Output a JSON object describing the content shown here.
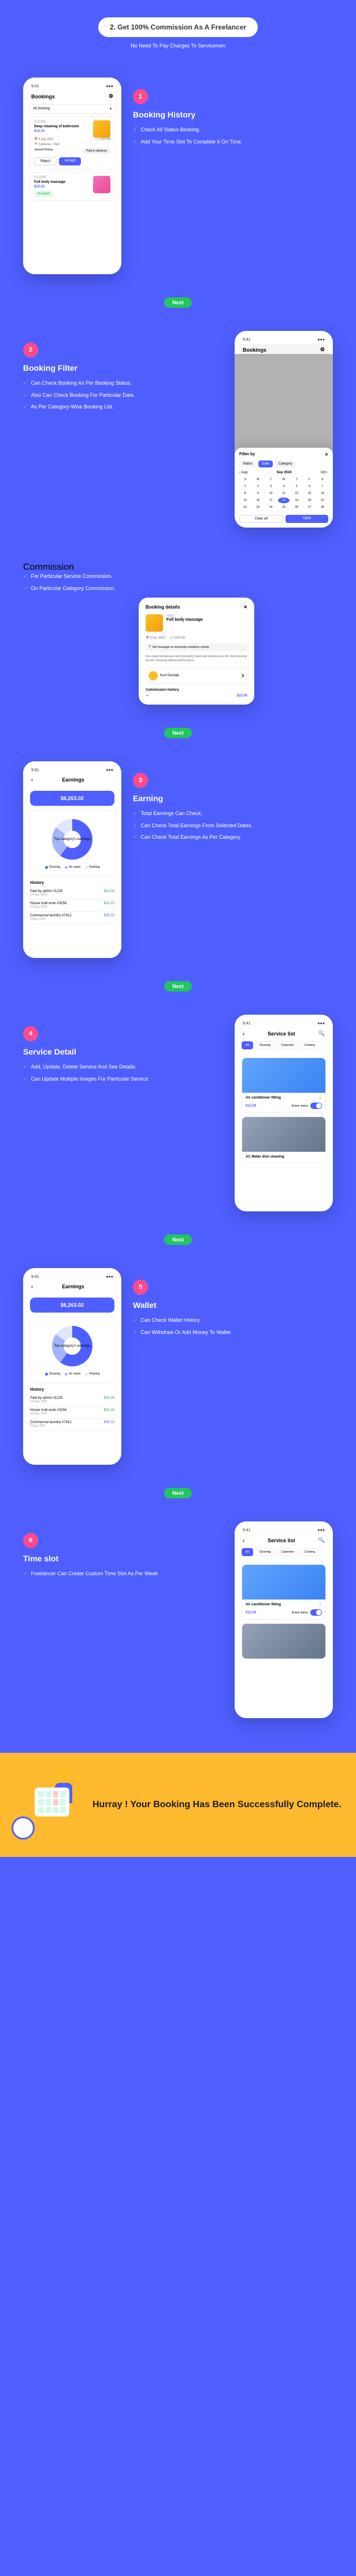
{
  "header": {
    "title": "2. Get 100% Commission As A Freelancer",
    "subtitle": "No Need To Pay Charges To Servicemen"
  },
  "next_label": "Next",
  "sections": {
    "s1": {
      "num": "1",
      "title": "Booking History",
      "items": [
        "Check All Status Booking.",
        "Add Your Time Slot To Complete It On Time."
      ],
      "phone": {
        "title": "Bookings",
        "filter_all": "All booking",
        "card1": {
          "id": "#15263",
          "name": "Deep cleaning of bathroom",
          "price": "$12.15",
          "date": "6 Sep 2023",
          "time": "6:00 PM",
          "location": "California - USA",
          "customer": "Javeed Khong",
          "payment": "Paid in advance",
          "btn_reject": "Reject",
          "btn_accept": "Accept"
        },
        "card2": {
          "id": "#12368",
          "name": "Full body massage",
          "price": "$15.23",
          "status": "Accepted"
        }
      }
    },
    "s2": {
      "num": "2",
      "title": "Booking Filter",
      "items": [
        "Can Check Booking As Per Booking Status.",
        "Also Can Check Booking For Particular Date.",
        "As Per Category-Wise Booking List."
      ],
      "phone": {
        "title": "Bookings",
        "filter_title": "Filter by",
        "tabs": [
          "Status",
          "Date",
          "Category"
        ],
        "month": "Sep 2024",
        "prev_month": "Aug",
        "next_month": "Oct",
        "btn_clear": "Clear all",
        "btn_apply": "Apply"
      }
    },
    "commission": {
      "title": "Commission",
      "items": [
        "For Particular Service Commission.",
        "On Particular Category Commission."
      ],
      "card": {
        "title": "Booking details",
        "id": "#5963",
        "name": "Full body massage",
        "date": "6 Oct, 2023",
        "time": "6:00 PM",
        "status": "Get message on terracotta combines exfolia",
        "desc": "Our expert technicians will thoroughly clean and sanitize your AC unit removing accum. ensuring optimal performance.",
        "customer": "Kurt Kendall",
        "history_label": "Commission history",
        "price": "$22.00"
      }
    },
    "s3": {
      "num": "3",
      "title": "Earning",
      "items": [
        "Total Earnings Can Check.",
        "Can Check Total Earnings From Selected Dates.",
        "Can Check Total Earnings As Per Category."
      ],
      "phone": {
        "title": "Earnings",
        "total": "$6,263.02",
        "donut_label": "Top category's earnings",
        "legend": [
          "Cleaning",
          "Ac repair",
          "Painting"
        ],
        "history_title": "History",
        "rows": [
          {
            "label": "Paid by admin #1225",
            "sub": "14 Aug, 2023",
            "val": "$22.00"
          },
          {
            "label": "House hold work #3256",
            "sub": "12 Aug, 2023",
            "val": "$31.23"
          },
          {
            "label": "Commercial laundry #7412",
            "sub": "9 Aug, 2023",
            "val": "$35.23"
          }
        ]
      }
    },
    "s4": {
      "num": "4",
      "title": "Service Detail",
      "items": [
        "Add, Update, Delete Service And See Details.",
        "Can Update Multiple Images For Particular Service"
      ],
      "phone": {
        "title": "Service list",
        "tabs": [
          "All",
          "Cleaning",
          "Carpenter",
          "Cooking"
        ],
        "card1": {
          "name": "Air conditioner fitting",
          "price": "$12.00",
          "status": "Active status"
        },
        "card2": {
          "name": "AC Water dish cleaning"
        }
      }
    },
    "s5": {
      "num": "5",
      "title": "Wallet",
      "items": [
        "Can Check Wallet History.",
        "Can Withdraw Or Add Money To Wallet"
      ],
      "phone": {
        "title": "Earnings",
        "total": "$6,263.02",
        "donut_label": "Top category's earnings",
        "legend": [
          "Cleaning",
          "Ac repair",
          "Painting"
        ],
        "history_title": "History",
        "rows": [
          {
            "label": "Paid by admin #1225",
            "sub": "14 Aug, 2023",
            "val": "$22.00"
          },
          {
            "label": "House hold work #3256",
            "sub": "12 Aug, 2023",
            "val": "$31.23"
          },
          {
            "label": "Commercial laundry #7412",
            "sub": "9 Aug, 2023",
            "val": "$35.23"
          }
        ]
      }
    },
    "s6": {
      "num": "6",
      "title": "Time slot",
      "items": [
        "Freelancer Can Create Custom Time Slot As Per Week"
      ],
      "phone": {
        "title": "Service list",
        "tabs": [
          "All",
          "Cleaning",
          "Carpenter",
          "Cooking"
        ],
        "card1": {
          "name": "Air conditioner fitting",
          "price": "$12.00",
          "status": "Active status"
        }
      }
    }
  },
  "footer": {
    "text": "Hurray ! Your Booking Has Been Successfully Complete."
  }
}
